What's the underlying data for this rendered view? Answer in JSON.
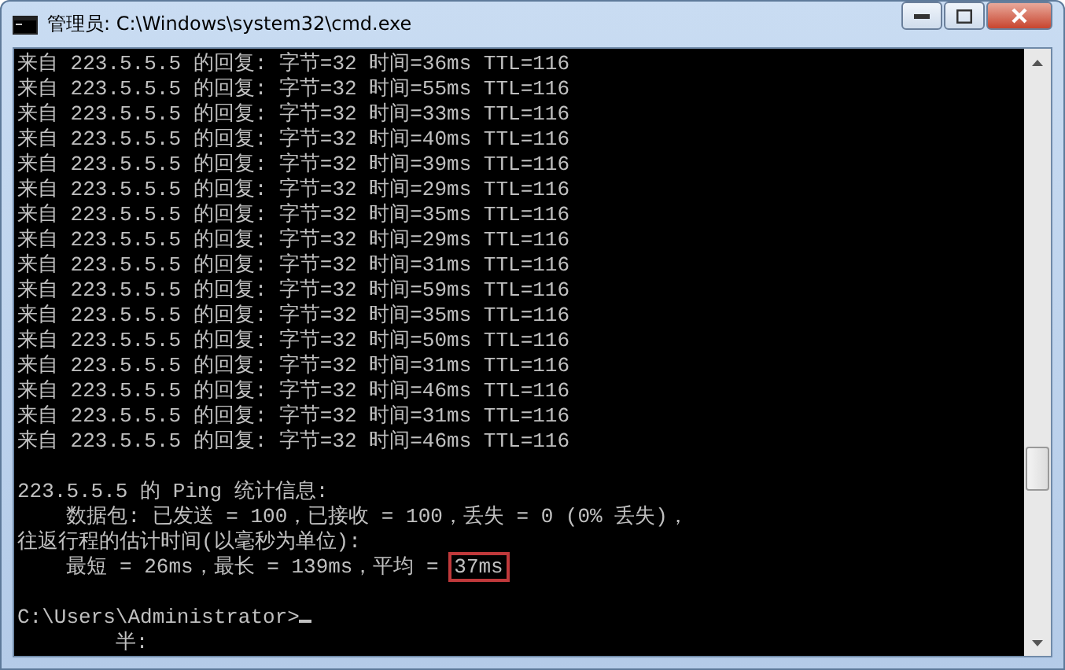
{
  "window": {
    "title": "管理员: C:\\Windows\\system32\\cmd.exe"
  },
  "console": {
    "replies": [
      "来自 223.5.5.5 的回复: 字节=32 时间=36ms TTL=116",
      "来自 223.5.5.5 的回复: 字节=32 时间=55ms TTL=116",
      "来自 223.5.5.5 的回复: 字节=32 时间=33ms TTL=116",
      "来自 223.5.5.5 的回复: 字节=32 时间=40ms TTL=116",
      "来自 223.5.5.5 的回复: 字节=32 时间=39ms TTL=116",
      "来自 223.5.5.5 的回复: 字节=32 时间=29ms TTL=116",
      "来自 223.5.5.5 的回复: 字节=32 时间=35ms TTL=116",
      "来自 223.5.5.5 的回复: 字节=32 时间=29ms TTL=116",
      "来自 223.5.5.5 的回复: 字节=32 时间=31ms TTL=116",
      "来自 223.5.5.5 的回复: 字节=32 时间=59ms TTL=116",
      "来自 223.5.5.5 的回复: 字节=32 时间=35ms TTL=116",
      "来自 223.5.5.5 的回复: 字节=32 时间=50ms TTL=116",
      "来自 223.5.5.5 的回复: 字节=32 时间=31ms TTL=116",
      "来自 223.5.5.5 的回复: 字节=32 时间=46ms TTL=116",
      "来自 223.5.5.5 的回复: 字节=32 时间=31ms TTL=116",
      "来自 223.5.5.5 的回复: 字节=32 时间=46ms TTL=116"
    ],
    "stats": [
      "223.5.5.5 的 Ping 统计信息:",
      "    数据包: 已发送 = 100，已接收 = 100，丢失 = 0 (0% 丢失)，",
      "往返行程的估计时间(以毫秒为单位):"
    ],
    "summary": {
      "text": "    最短 = 26ms，最长 = 139ms，平均 = ",
      "highlighted": "37ms"
    },
    "prompt": "C:\\Users\\Administrator>",
    "ime_status": "        半:"
  }
}
